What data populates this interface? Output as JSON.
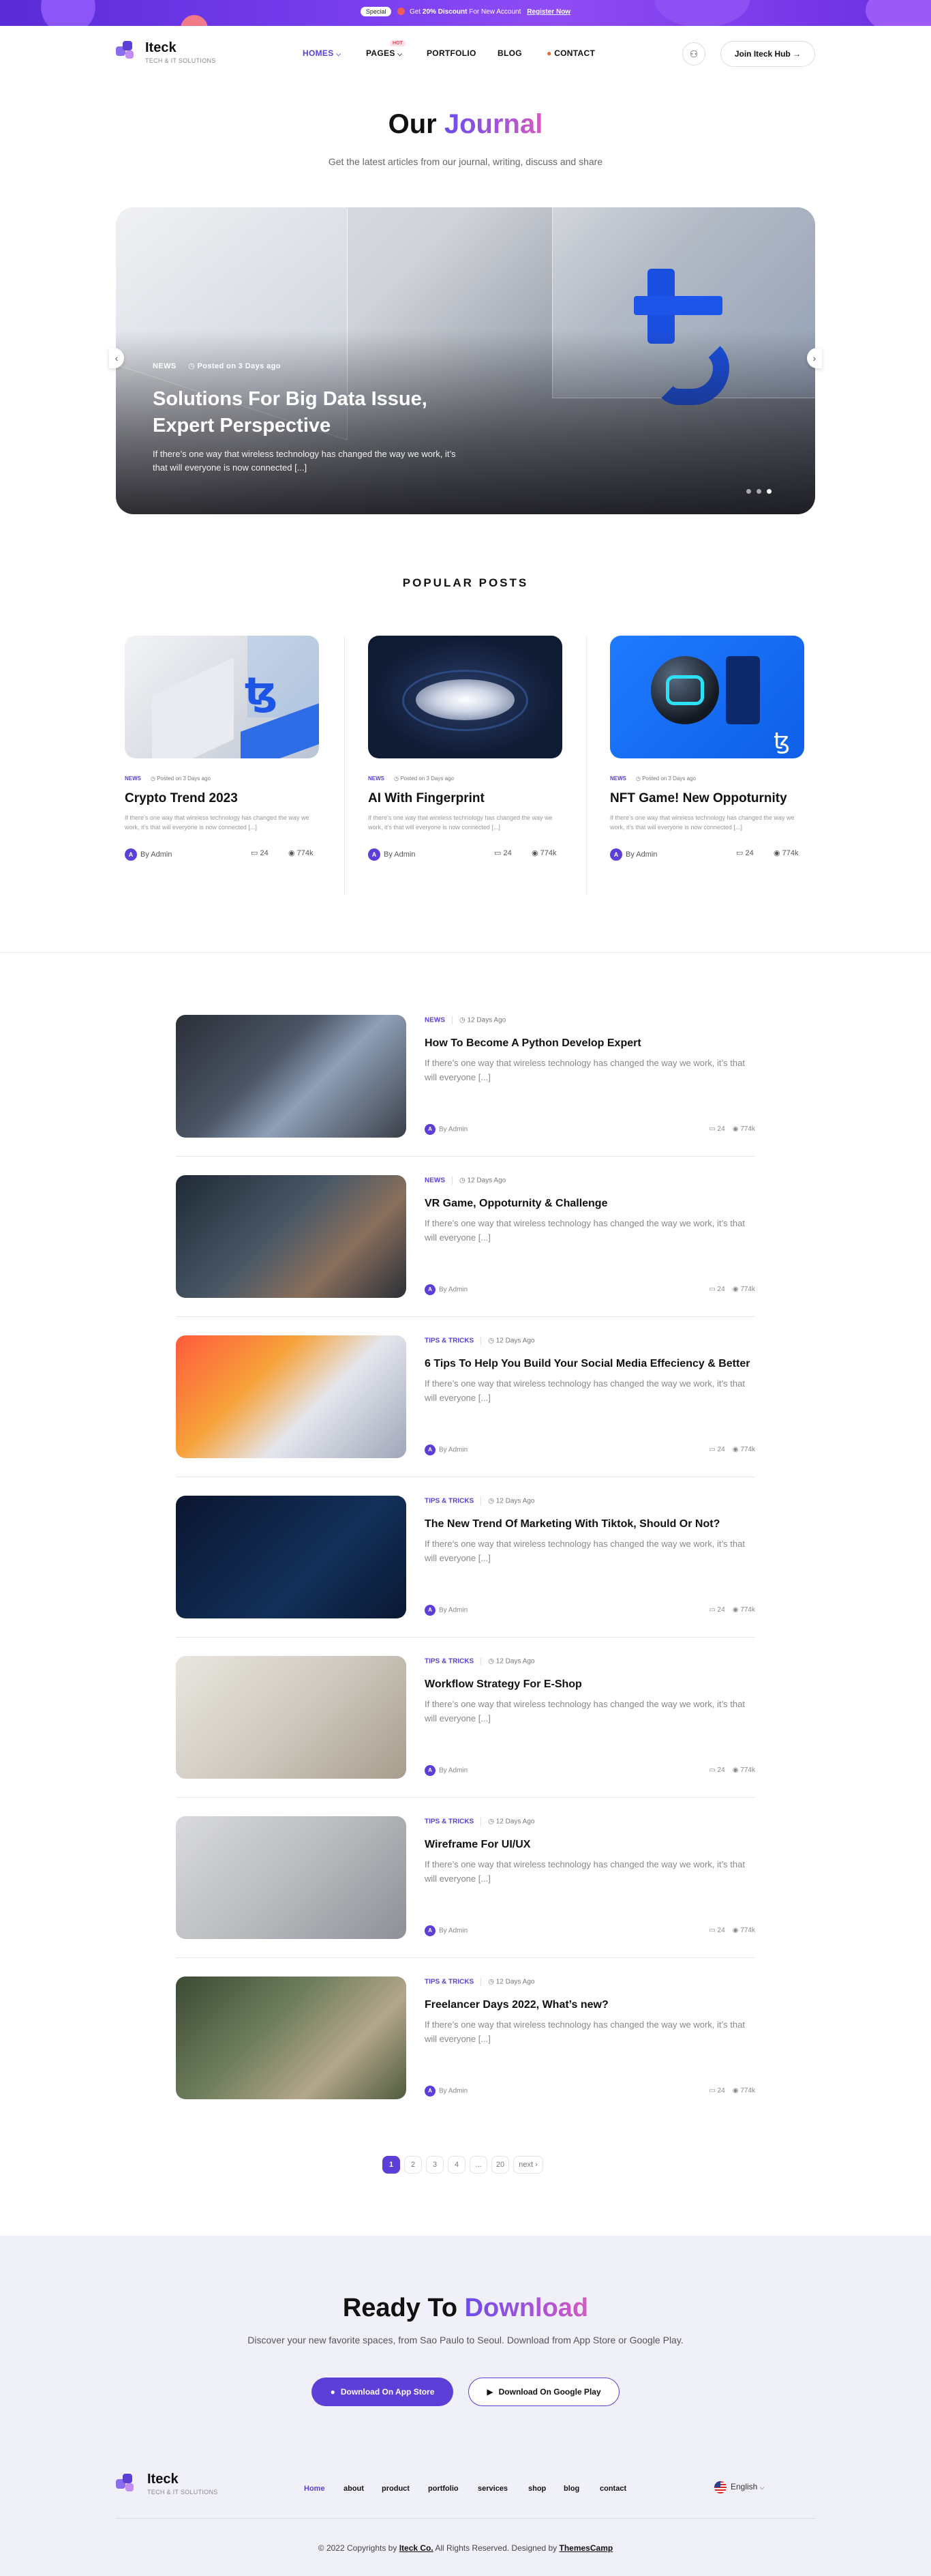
{
  "banner": {
    "tag": "Special",
    "pre": "Get",
    "discount": "20% Discount",
    "rest": "For New Account",
    "link": "Register Now"
  },
  "brand": {
    "name": "Iteck",
    "tagline": "TECH & IT SOLUTIONS"
  },
  "nav": {
    "items": [
      {
        "label": "HOMES",
        "chevron": "⌵"
      },
      {
        "label": "PAGES",
        "chevron": "⌵"
      },
      {
        "label": "PORTFOLIO"
      },
      {
        "label": "BLOG"
      },
      {
        "label": "CONTACT"
      }
    ],
    "hot_badge": "HOT",
    "join_label": "Join Iteck Hub",
    "join_arrow": "→"
  },
  "journal": {
    "title_plain": "Our",
    "title_accent": "Journal",
    "subtitle": "Get the latest articles from our journal, writing, discuss and share"
  },
  "slider": {
    "category": "NEWS",
    "posted": "Posted on 3 Days ago",
    "title": "Solutions For Big Data Issue, Expert Perspective",
    "description": "If there’s one way that wireless technology has changed the way we work, it’s that will everyone is now connected [...]",
    "active_slide": 3,
    "slides": 3
  },
  "popular": {
    "heading": "POPULAR POSTS",
    "posts": [
      {
        "category": "NEWS",
        "posted": "Posted on 3 Days ago",
        "title": "Crypto Trend 2023",
        "desc": "If there’s one way that wireless technology has changed the way we work, it’s that will everyone is now connected [...]",
        "author": "By Admin",
        "comments": "24",
        "views": "774k"
      },
      {
        "category": "NEWS",
        "posted": "Posted on 3 Days ago",
        "title": "AI With Fingerprint",
        "desc": "If there’s one way that wireless technology has changed the way we work, it’s that will everyone is now connected [...]",
        "author": "By Admin",
        "comments": "24",
        "views": "774k"
      },
      {
        "category": "NEWS",
        "posted": "Posted on 3 Days ago",
        "title": "NFT Game! New Oppoturnity",
        "desc": "If there’s one way that wireless technology has changed the way we work, it’s that will everyone is now connected [...]",
        "author": "By Admin",
        "comments": "24",
        "views": "774k"
      }
    ]
  },
  "posts": [
    {
      "category": "NEWS",
      "date": "12 Days Ago",
      "title": "How To Become A Python Develop Expert",
      "desc": "If there’s one way that wireless technology has changed the way we work, it’s that will everyone [...]",
      "author": "By Admin",
      "comments": "24",
      "views": "774k"
    },
    {
      "category": "NEWS",
      "date": "12 Days Ago",
      "title": "VR Game, Oppoturnity & Challenge",
      "desc": "If there’s one way that wireless technology has changed the way we work, it’s that will everyone [...]",
      "author": "By Admin",
      "comments": "24",
      "views": "774k"
    },
    {
      "category": "TIPS & TRICKS",
      "date": "12 Days Ago",
      "title": "6 Tips To Help You Build Your Social Media Effeciency & Better",
      "desc": "If there’s one way that wireless technology has changed the way we work, it’s that will everyone [...]",
      "author": "By Admin",
      "comments": "24",
      "views": "774k"
    },
    {
      "category": "TIPS & TRICKS",
      "date": "12 Days Ago",
      "title": "The New Trend Of Marketing With Tiktok, Should Or Not?",
      "desc": "If there’s one way that wireless technology has changed the way we work, it’s that will everyone [...]",
      "author": "By Admin",
      "comments": "24",
      "views": "774k"
    },
    {
      "category": "TIPS & TRICKS",
      "date": "12 Days Ago",
      "title": "Workflow Strategy For E-Shop",
      "desc": "If there’s one way that wireless technology has changed the way we work, it’s that will everyone [...]",
      "author": "By Admin",
      "comments": "24",
      "views": "774k"
    },
    {
      "category": "TIPS & TRICKS",
      "date": "12 Days Ago",
      "title": "Wireframe For UI/UX",
      "desc": "If there’s one way that wireless technology has changed the way we work, it’s that will everyone [...]",
      "author": "By Admin",
      "comments": "24",
      "views": "774k"
    },
    {
      "category": "TIPS & TRICKS",
      "date": "12 Days Ago",
      "title": "Freelancer Days 2022, What’s new?",
      "desc": "If there’s one way that wireless technology has changed the way we work, it’s that will everyone [...]",
      "author": "By Admin",
      "comments": "24",
      "views": "774k"
    }
  ],
  "pagination": {
    "pages": [
      "1",
      "2",
      "3",
      "4",
      "...",
      "20"
    ],
    "next": "next",
    "next_icon": "›",
    "current": "1"
  },
  "download": {
    "title_plain": "Ready To",
    "title_accent": "Download",
    "subtitle": "Discover your new favorite spaces, from Sao Paulo to Seoul. Download from App Store or Google Play.",
    "app_store": "Download On App Store",
    "google_play": "Download On Google Play"
  },
  "footer": {
    "brand": "Iteck",
    "tagline": "TECH & IT SOLUTIONS",
    "nav": [
      "Home",
      "about",
      "product",
      "portfolio",
      "services",
      "shop",
      "blog",
      "contact"
    ],
    "language": "English",
    "copy_pre": "© 2022 Copyrights by",
    "copy_company": "Iteck Co.",
    "copy_mid": "All Rights Reserved. Designed by",
    "copy_designer": "ThemesCamp"
  },
  "colors": {
    "accent": "#5b3fd6",
    "accent_pink": "#d35ac2",
    "banner": "#6a35e6",
    "footer_bg": "#f0f1f8"
  }
}
